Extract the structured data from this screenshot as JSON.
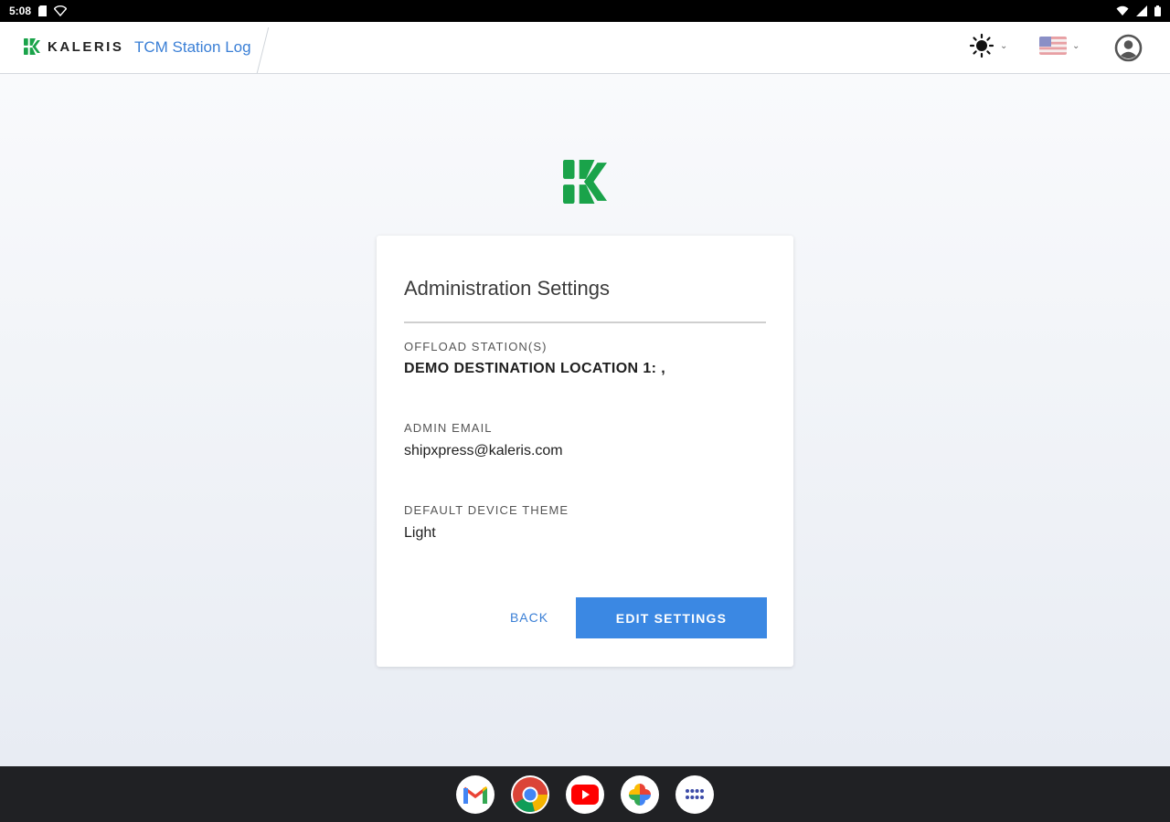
{
  "status_bar": {
    "time": "5:08"
  },
  "app_bar": {
    "brand": "KALERIS",
    "title": "TCM Station Log",
    "icons": {
      "theme": "sun-icon",
      "language": "us-flag-icon",
      "account": "account-circle-icon"
    }
  },
  "card": {
    "title": "Administration Settings",
    "fields": [
      {
        "label": "OFFLOAD STATION(S)",
        "value": "DEMO DESTINATION LOCATION 1: ,"
      },
      {
        "label": "ADMIN EMAIL",
        "value": "shipxpress@kaleris.com"
      },
      {
        "label": "DEFAULT DEVICE THEME",
        "value": "Light"
      }
    ],
    "back_label": "BACK",
    "edit_label": "EDIT SETTINGS"
  },
  "dock": {
    "apps": [
      "gmail-icon",
      "chrome-icon",
      "youtube-icon",
      "photos-icon",
      "app-drawer-icon"
    ]
  },
  "colors": {
    "brand_green": "#1aa34a",
    "accent_blue": "#3b88e3",
    "link_blue": "#3a7fd6"
  }
}
